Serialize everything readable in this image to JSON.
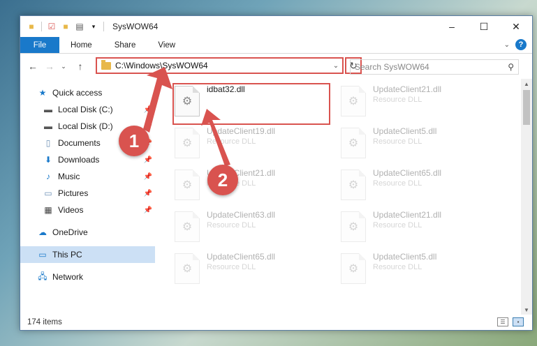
{
  "window": {
    "title": "SysWOW64",
    "controls": {
      "minimize": "–",
      "maximize": "☐",
      "close": "✕"
    }
  },
  "ribbon": {
    "tabs": [
      "File",
      "Home",
      "Share",
      "View"
    ],
    "help": "?"
  },
  "nav": {
    "address": "C:\\Windows\\SysWOW64",
    "search_placeholder": "Search SysWOW64"
  },
  "sidebar": {
    "quick_access": "Quick access",
    "pinned": [
      {
        "label": "Local Disk (C:)",
        "icon": "drive-icon"
      },
      {
        "label": "Local Disk (D:)",
        "icon": "drive-icon"
      },
      {
        "label": "Documents",
        "icon": "documents-icon"
      },
      {
        "label": "Downloads",
        "icon": "downloads-icon"
      },
      {
        "label": "Music",
        "icon": "music-icon"
      },
      {
        "label": "Pictures",
        "icon": "pictures-icon"
      },
      {
        "label": "Videos",
        "icon": "videos-icon"
      }
    ],
    "onedrive": "OneDrive",
    "this_pc": "This PC",
    "network": "Network"
  },
  "files": [
    {
      "name": "idbat32.dll",
      "type": "",
      "highlighted": true
    },
    {
      "name": "UpdateClient21.dll",
      "type": "Resource DLL"
    },
    {
      "name": "UpdateClient19.dll",
      "type": "Resource DLL"
    },
    {
      "name": "UpdateClient5.dll",
      "type": "Resource DLL"
    },
    {
      "name": "UpdateClient21.dll",
      "type": "Resource DLL"
    },
    {
      "name": "UpdateClient65.dll",
      "type": "Resource DLL"
    },
    {
      "name": "UpdateClient63.dll",
      "type": "Resource DLL"
    },
    {
      "name": "UpdateClient21.dll",
      "type": "Resource DLL"
    },
    {
      "name": "UpdateClient65.dll",
      "type": "Resource DLL"
    },
    {
      "name": "UpdateClient5.dll",
      "type": "Resource DLL"
    }
  ],
  "status": {
    "item_count": "174 items"
  },
  "annotations": {
    "step1": "1",
    "step2": "2",
    "color": "#d9534f"
  }
}
